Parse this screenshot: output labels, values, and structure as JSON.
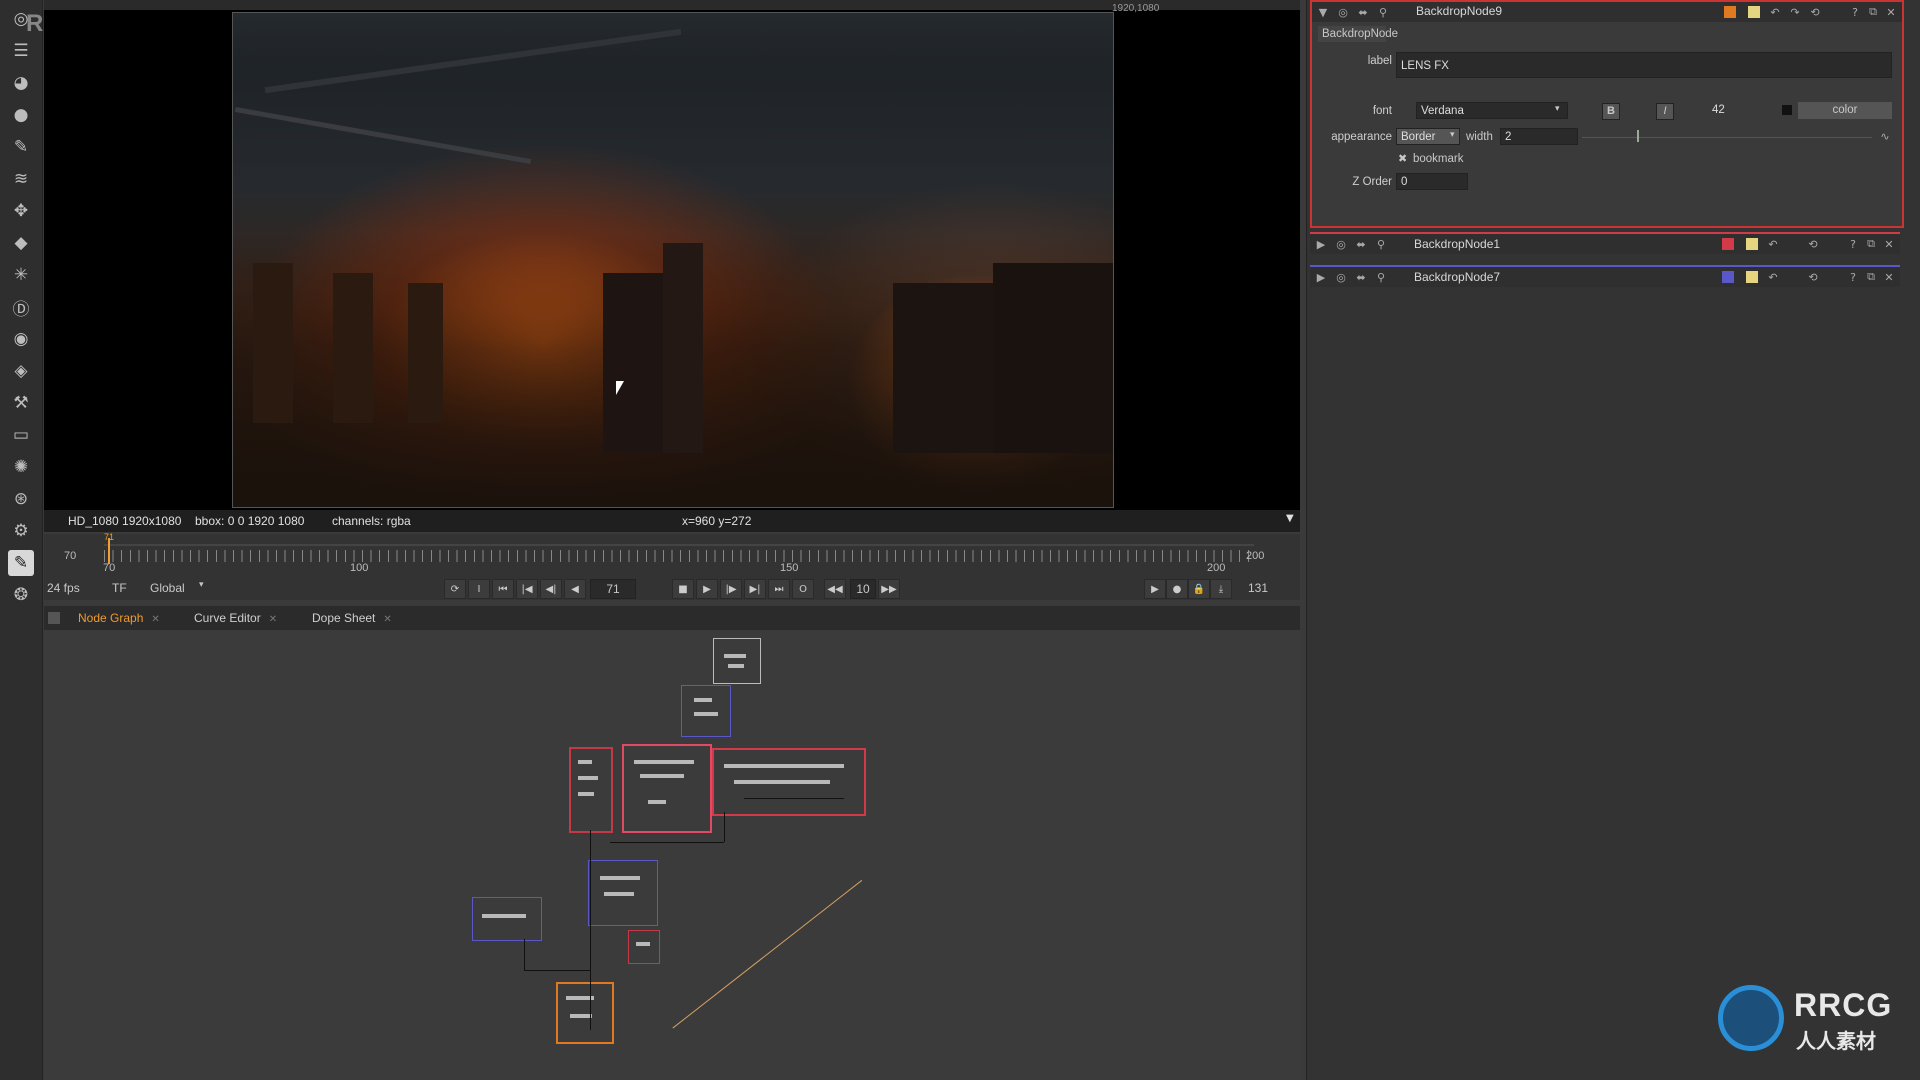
{
  "viewer": {
    "format_label": "HD_1080 1920x1080",
    "bbox_label": "bbox: 0 0 1920 1080",
    "channels_label": "channels: rgba",
    "coords_label": "x=960 y=272",
    "frame_dims": "1920,1080"
  },
  "timeline": {
    "in_point": "70",
    "out_point": "200",
    "tick_70": "70",
    "tick_100": "100",
    "tick_150": "150",
    "tick_200": "200",
    "current_frame_marker": "71"
  },
  "transport": {
    "fps": "24 fps",
    "tf": "TF",
    "global": "Global",
    "current_frame": "71",
    "step": "10",
    "end_frame": "131"
  },
  "tabs": [
    {
      "label": "Node Graph",
      "active": true
    },
    {
      "label": "Curve Editor",
      "active": false
    },
    {
      "label": "Dope Sheet",
      "active": false
    }
  ],
  "properties": {
    "node9": {
      "title": "BackdropNode9",
      "class_label": "BackdropNode",
      "label_label": "label",
      "label_value": "LENS FX",
      "font_label": "font",
      "font_value": "Verdana",
      "bold": "B",
      "italic": "I",
      "font_size": "42",
      "color_label": "color",
      "appearance_label": "appearance",
      "appearance_value": "Border",
      "width_label": "width",
      "width_value": "2",
      "bookmark_label": "bookmark",
      "zorder_label": "Z Order",
      "zorder_value": "0",
      "swatch": "#e07a22"
    },
    "node1": {
      "title": "BackdropNode1",
      "swatch": "#d23a4a"
    },
    "node7": {
      "title": "BackdropNode7",
      "swatch": "#5a58c8"
    }
  },
  "watermark": {
    "top_left": "RRCG",
    "logo_text": "RRCG",
    "logo_sub": "人人素材"
  },
  "colors": {
    "accent_orange": "#f09a2d",
    "backdrop_red": "#d23a4a",
    "backdrop_blue": "#5a58c8",
    "backdrop_orange": "#e07a22"
  }
}
